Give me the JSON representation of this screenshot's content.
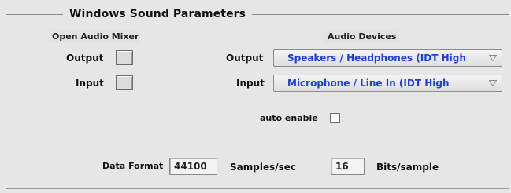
{
  "group_title": "Windows Sound Parameters",
  "mixer": {
    "title": "Open Audio Mixer",
    "output_label": "Output",
    "input_label": "Input"
  },
  "devices": {
    "title": "Audio Devices",
    "output_label": "Output",
    "output_value": "Speakers / Headphones (IDT High",
    "input_label": "Input",
    "input_value": "Microphone / Line In (IDT High"
  },
  "auto_enable": {
    "label": "auto enable",
    "checked": false
  },
  "format": {
    "label": "Data Format",
    "rate_value": "44100",
    "rate_unit": "Samples/sec",
    "bits_value": "16",
    "bits_unit": "Bits/sample"
  }
}
